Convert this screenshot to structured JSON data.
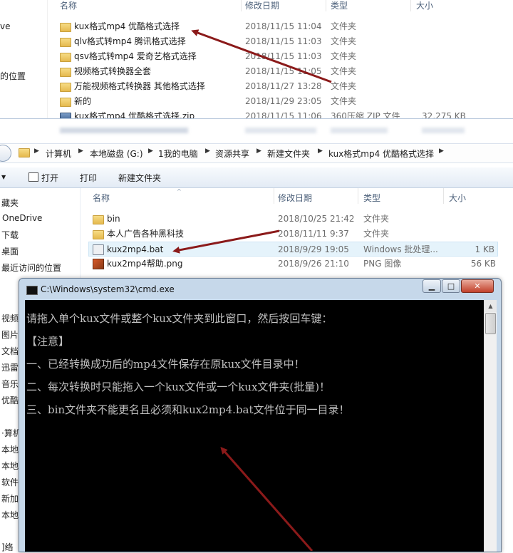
{
  "top_window": {
    "sidebar": [
      "ve",
      "",
      "",
      "的位置"
    ],
    "headers": {
      "name": "名称",
      "modified": "修改日期",
      "type": "类型",
      "size": "大小"
    },
    "files": [
      {
        "name": "kux格式mp4 优酷格式选择",
        "date": "2018/11/15 11:04",
        "type": "文件夹",
        "size": "",
        "kind": "folder"
      },
      {
        "name": "qlv格式转mp4  腾讯格式选择",
        "date": "2018/11/15 11:03",
        "type": "文件夹",
        "size": "",
        "kind": "folder"
      },
      {
        "name": "qsv格式转mp4  爱奇艺格式选择",
        "date": "2018/11/15 11:03",
        "type": "文件夹",
        "size": "",
        "kind": "folder"
      },
      {
        "name": "视频格式转换器全套",
        "date": "2018/11/15 11:05",
        "type": "文件夹",
        "size": "",
        "kind": "folder"
      },
      {
        "name": "万能视频格式转换器  其他格式选择",
        "date": "2018/11/27 13:28",
        "type": "文件夹",
        "size": "",
        "kind": "folder"
      },
      {
        "name": "新的",
        "date": "2018/11/29 23:05",
        "type": "文件夹",
        "size": "",
        "kind": "folder"
      },
      {
        "name": "kux格式mp4 优酷格式选择.zip",
        "date": "2018/11/15 11:06",
        "type": "360压缩 ZIP 文件",
        "size": "32,275 KB",
        "kind": "zip"
      }
    ]
  },
  "middle_window": {
    "breadcrumb": [
      "计算机",
      "本地磁盘 (G:)",
      "1我的电脑",
      "资源共享",
      "新建文件夹",
      "kux格式mp4 优酷格式选择"
    ],
    "toolbar": {
      "open": "打开",
      "print": "打印",
      "new_folder": "新建文件夹"
    },
    "nav": [
      "藏夹",
      "OneDrive",
      "下载",
      "桌面",
      "最近访问的位置"
    ],
    "headers": {
      "name": "名称",
      "modified": "修改日期",
      "type": "类型",
      "size": "大小"
    },
    "files": [
      {
        "name": "bin",
        "date": "2018/10/25 21:42",
        "type": "文件夹",
        "size": "",
        "kind": "folder"
      },
      {
        "name": "本人广告各种黑科技",
        "date": "2018/11/11 9:37",
        "type": "文件夹",
        "size": "",
        "kind": "folder"
      },
      {
        "name": "kux2mp4.bat",
        "date": "2018/9/29 19:05",
        "type": "Windows 批处理...",
        "size": "1 KB",
        "kind": "bat"
      },
      {
        "name": "kux2mp4帮助.png",
        "date": "2018/9/26 21:10",
        "type": "PNG 图像",
        "size": "56 KB",
        "kind": "png"
      }
    ]
  },
  "left_strip": [
    "视频",
    "图片",
    "文档",
    "迅雷",
    "音乐",
    "优酷",
    "·算机",
    "本地",
    "本地",
    "软件",
    "新加",
    "本地",
    "]络"
  ],
  "cmd": {
    "title": "C:\\Windows\\system32\\cmd.exe",
    "lines": [
      "请拖入单个kux文件或整个kux文件夹到此窗口，然后按回车键：",
      "【注意】",
      "一、已经转换成功后的mp4文件保存在原kux文件目录中！",
      "二、每次转换时只能拖入一个kux文件或一个kux文件夹(批量)！",
      "三、bin文件夹不能更名且必须和kux2mp4.bat文件位于同一目录！"
    ]
  },
  "colors": {
    "arrow": "#8b1a1a",
    "console_bg": "#000000",
    "console_text": "#c0c0c0"
  }
}
